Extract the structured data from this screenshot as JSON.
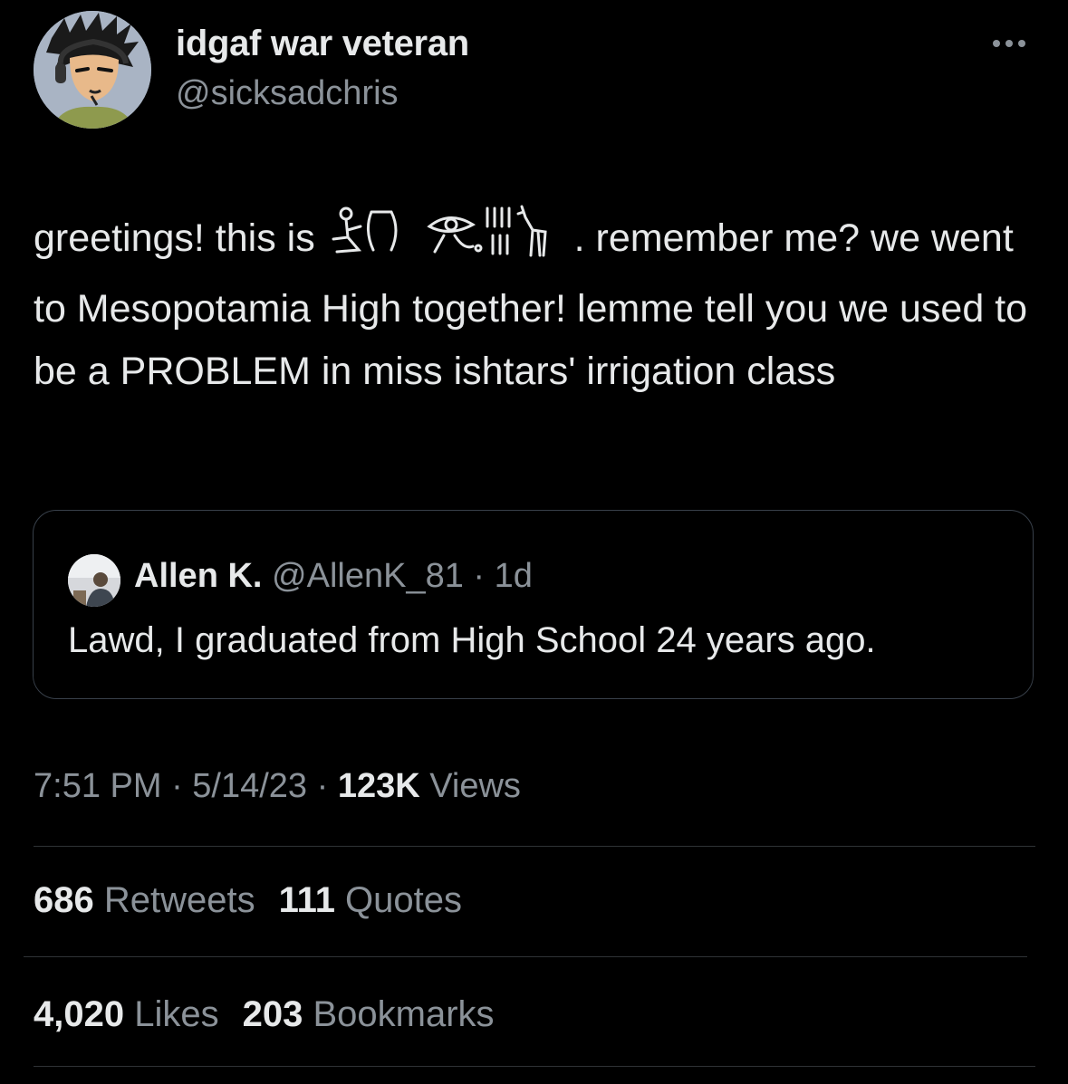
{
  "tweet": {
    "author": {
      "display_name": "idgaf war veteran",
      "handle": "@sicksadchris",
      "avatar_icon": "cartoon-avatar-with-headphones"
    },
    "more_icon": "more-horizontal-icon",
    "text_before_glyphs": "greetings! this is ",
    "glyphs_icon": "egyptian-hieroglyphs-name",
    "text_after_glyphs": ". remember me? we went to Mesopotamia High together! lemme tell you we used to be a PROBLEM in miss ishtars' irrigation class",
    "quoted": {
      "avatar_icon": "photo-avatar",
      "name": "Allen K.",
      "handle_time": "@AllenK_81 · 1d",
      "text": "Lawd, I graduated from High School 24 years ago."
    },
    "meta": {
      "time_date": "7:51 PM · 5/14/23 · ",
      "views_count": "123K",
      "views_label": " Views"
    },
    "stats": {
      "retweets_count": "686",
      "retweets_label": " Retweets",
      "quotes_count": "111",
      "quotes_label": " Quotes",
      "likes_count": "4,020",
      "likes_label": " Likes",
      "bookmarks_count": "203",
      "bookmarks_label": " Bookmarks"
    }
  },
  "colors": {
    "background": "#000000",
    "primary_text": "#e7e9ea",
    "secondary_text": "#8b9299",
    "border": "#2f3336"
  }
}
